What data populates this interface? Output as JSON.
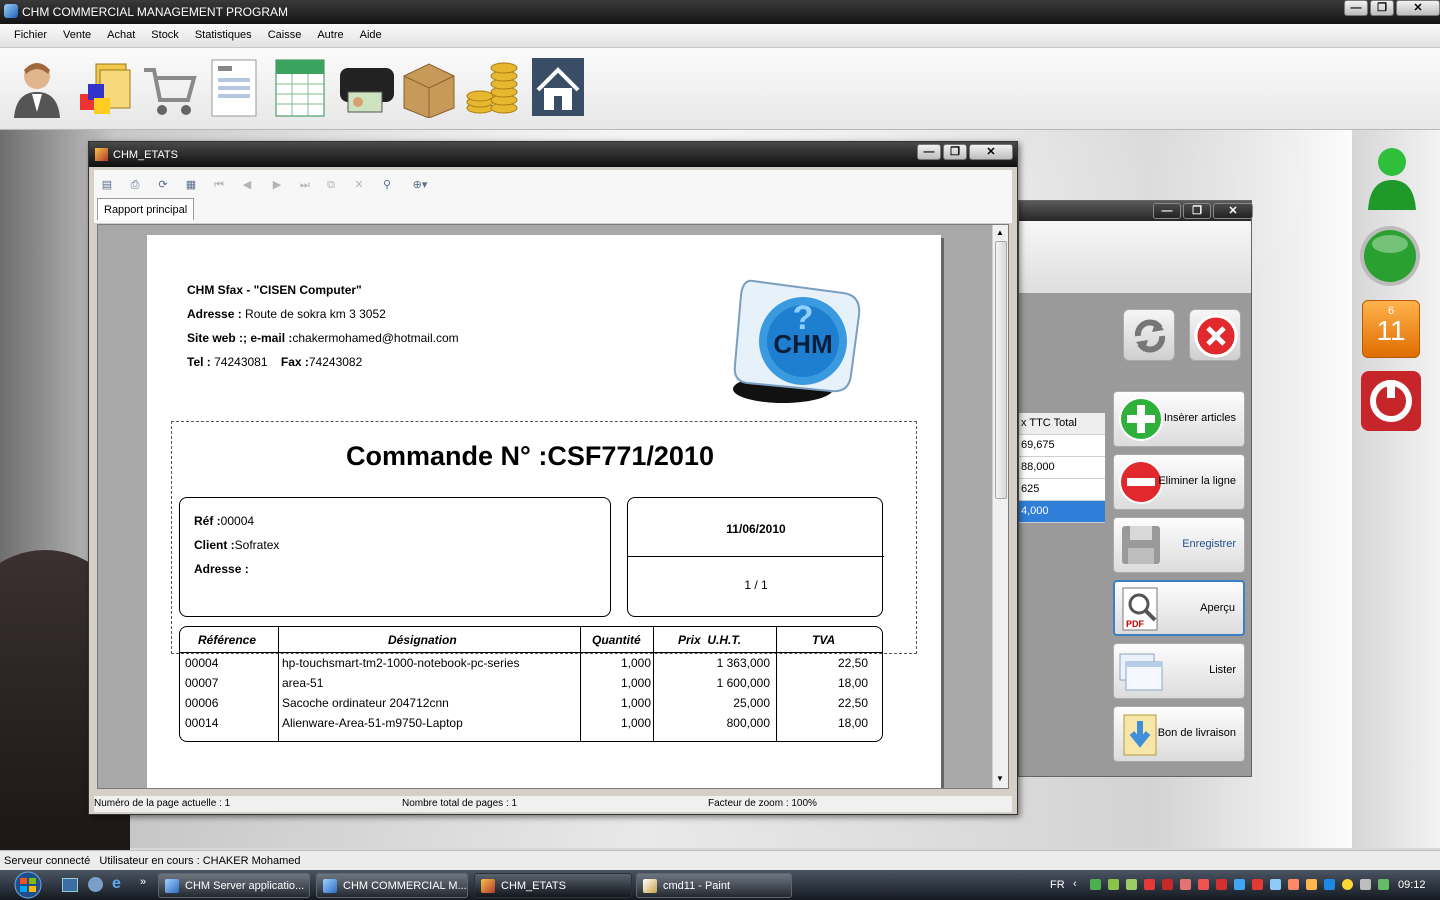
{
  "app": {
    "title": "CHM COMMERCIAL MANAGEMENT PROGRAM",
    "menu": [
      "Fichier",
      "Vente",
      "Achat",
      "Stock",
      "Statistiques",
      "Caisse",
      "Autre",
      "Aide"
    ],
    "toolbar_icons": [
      "user-icon",
      "products-icon",
      "cart-icon",
      "invoice-icon",
      "spreadsheet-icon",
      "wallet-icon",
      "box-icon",
      "coins-icon",
      "home-icon"
    ],
    "window_controls": {
      "minimize": "—",
      "restore": "❐",
      "close": "✕"
    }
  },
  "report_window": {
    "title": "CHM_ETATS",
    "tab": "Rapport principal",
    "status": {
      "current_page": "Numéro de la page actuelle : 1",
      "total_pages": "Nombre total de pages : 1",
      "zoom": "Facteur de zoom : 100%"
    },
    "report": {
      "company": "CHM Sfax - \"CISEN Computer\"",
      "address_label": "Adresse :",
      "address": "Route de sokra km 3   3052",
      "web_label": "Site web :; e-mail :",
      "email": "chakermohamed@hotmail.com",
      "tel_label": "Tel :",
      "tel": "74243081",
      "fax_label": "Fax :",
      "fax": "74243082",
      "logo_text": "CHM",
      "order_title": "Commande N° :CSF771/2010",
      "ref_label": "Réf :",
      "ref": "00004",
      "client_label": "Client :",
      "client": "Sofratex",
      "adresse_label": "Adresse :",
      "date": "11/06/2010",
      "page": "1 / 1",
      "columns": [
        "Référence",
        "Désignation",
        "Quantité",
        "Prix  U.H.T.",
        "TVA"
      ],
      "rows": [
        [
          "00004",
          "hp-touchsmart-tm2-1000-notebook-pc-series",
          "1,000",
          "1 363,000",
          "22,50"
        ],
        [
          "00007",
          "area-51",
          "1,000",
          "1 600,000",
          "18,00"
        ],
        [
          "00006",
          "Sacoche ordinateur 204712cnn",
          "1,000",
          "25,000",
          "22,50"
        ],
        [
          "00014",
          "Alienware-Area-51-m9750-Laptop",
          "1,000",
          "800,000",
          "18,00"
        ]
      ]
    }
  },
  "bg_window": {
    "grid_header": "x TTC Total",
    "grid_values": [
      "69,675",
      "88,000",
      "625",
      "4,000"
    ],
    "buttons": [
      "Insèrer articles",
      "Eliminer la ligne",
      "Enregistrer",
      "Aperçu",
      "Lister",
      "Bon de livraison"
    ]
  },
  "right_panel": {
    "calendar_month": "6",
    "calendar_day": "11"
  },
  "statusbar": {
    "text": "Serveur connecté   Utilisateur en cours : CHAKER Mohamed"
  },
  "taskbar": {
    "items": [
      "CHM Server applicatio...",
      "CHM COMMERCIAL M...",
      "CHM_ETATS",
      "cmd11 - Paint"
    ],
    "lang": "FR",
    "time": "09:12"
  }
}
